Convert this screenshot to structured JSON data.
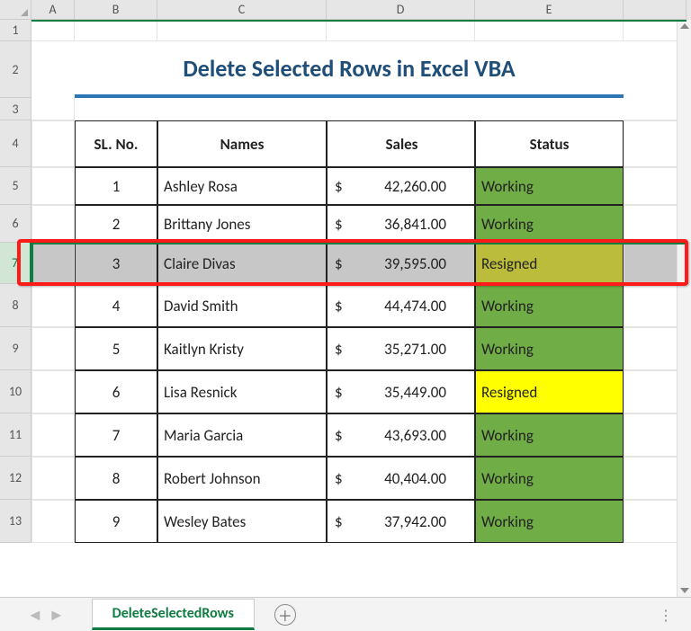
{
  "columns": {
    "A": "A",
    "B": "B",
    "C": "C",
    "D": "D",
    "E": "E",
    "F": " "
  },
  "rownums": {
    "r1": "1",
    "r2": "2",
    "r3": "3",
    "r4": "4",
    "r5": "5",
    "r6": "6",
    "r7": "7",
    "r8": "8",
    "r9": "9",
    "r10": "10",
    "r11": "11",
    "r12": "12",
    "r13": "13"
  },
  "title": "Delete Selected Rows in Excel VBA",
  "headers": {
    "sl": "SL. No.",
    "names": "Names",
    "sales": "Sales",
    "status": "Status"
  },
  "rows": [
    {
      "sl": "1",
      "name": "Ashley Rosa",
      "sales": "42,260.00",
      "status": "Working",
      "status_class": "working"
    },
    {
      "sl": "2",
      "name": "Brittany Jones",
      "sales": "36,841.00",
      "status": "Working",
      "status_class": "working"
    },
    {
      "sl": "3",
      "name": "Claire Divas",
      "sales": "39,595.00",
      "status": "Resigned",
      "status_class": "resigned"
    },
    {
      "sl": "4",
      "name": "David Smith",
      "sales": "44,474.00",
      "status": "Working",
      "status_class": "working"
    },
    {
      "sl": "5",
      "name": "Kaitlyn Kristy",
      "sales": "35,271.00",
      "status": "Working",
      "status_class": "working"
    },
    {
      "sl": "6",
      "name": "Lisa Resnick",
      "sales": "35,449.00",
      "status": "Resigned",
      "status_class": "resigned"
    },
    {
      "sl": "7",
      "name": "Maria Garcia",
      "sales": "43,693.00",
      "status": "Working",
      "status_class": "working"
    },
    {
      "sl": "8",
      "name": "Robert Johnson",
      "sales": "40,404.00",
      "status": "Working",
      "status_class": "working"
    },
    {
      "sl": "9",
      "name": "Wesley Bates",
      "sales": "37,942.00",
      "status": "Working",
      "status_class": "working"
    }
  ],
  "currency": "$",
  "sheet_tab": "DeleteSelectedRows",
  "chart_data": {
    "type": "table",
    "title": "Delete Selected Rows in Excel VBA",
    "columns": [
      "SL. No.",
      "Names",
      "Sales",
      "Status"
    ],
    "rows": [
      [
        1,
        "Ashley Rosa",
        42260.0,
        "Working"
      ],
      [
        2,
        "Brittany Jones",
        36841.0,
        "Working"
      ],
      [
        3,
        "Claire Divas",
        39595.0,
        "Resigned"
      ],
      [
        4,
        "David Smith",
        44474.0,
        "Working"
      ],
      [
        5,
        "Kaitlyn Kristy",
        35271.0,
        "Working"
      ],
      [
        6,
        "Lisa Resnick",
        35449.0,
        "Resigned"
      ],
      [
        7,
        "Maria Garcia",
        43693.0,
        "Working"
      ],
      [
        8,
        "Robert Johnson",
        40404.0,
        "Working"
      ],
      [
        9,
        "Wesley Bates",
        37942.0,
        "Working"
      ]
    ],
    "selected_row_index": 2
  }
}
